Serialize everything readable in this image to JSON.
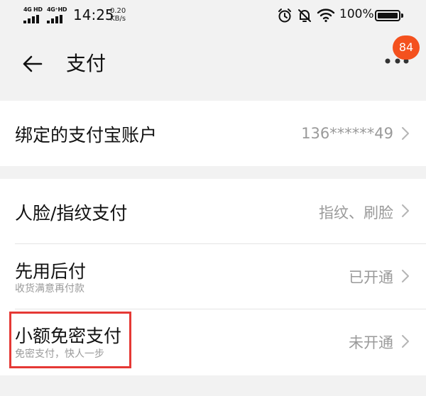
{
  "status_bar": {
    "network1": "4G HD",
    "network2": "4G⁺HD",
    "time": "14:25",
    "speed_value": "0.20",
    "speed_unit": "KB/s",
    "battery_percent": "100%",
    "battery_level": 1.0
  },
  "header": {
    "title": "支付",
    "notification_count": "84"
  },
  "sections": {
    "alipay": {
      "label": "绑定的支付宝账户",
      "value": "136******49"
    },
    "face_fingerprint": {
      "label": "人脸/指纹支付",
      "value": "指纹、刷脸"
    },
    "pay_later": {
      "label": "先用后付",
      "sublabel": "收货满意再付款",
      "value": "已开通"
    },
    "small_free_pay": {
      "label": "小额免密支付",
      "sublabel": "免密支付，快人一步",
      "value": "未开通"
    }
  },
  "colors": {
    "badge": "#f4511e",
    "highlight": "#e53935",
    "background": "#f2f2f2"
  }
}
